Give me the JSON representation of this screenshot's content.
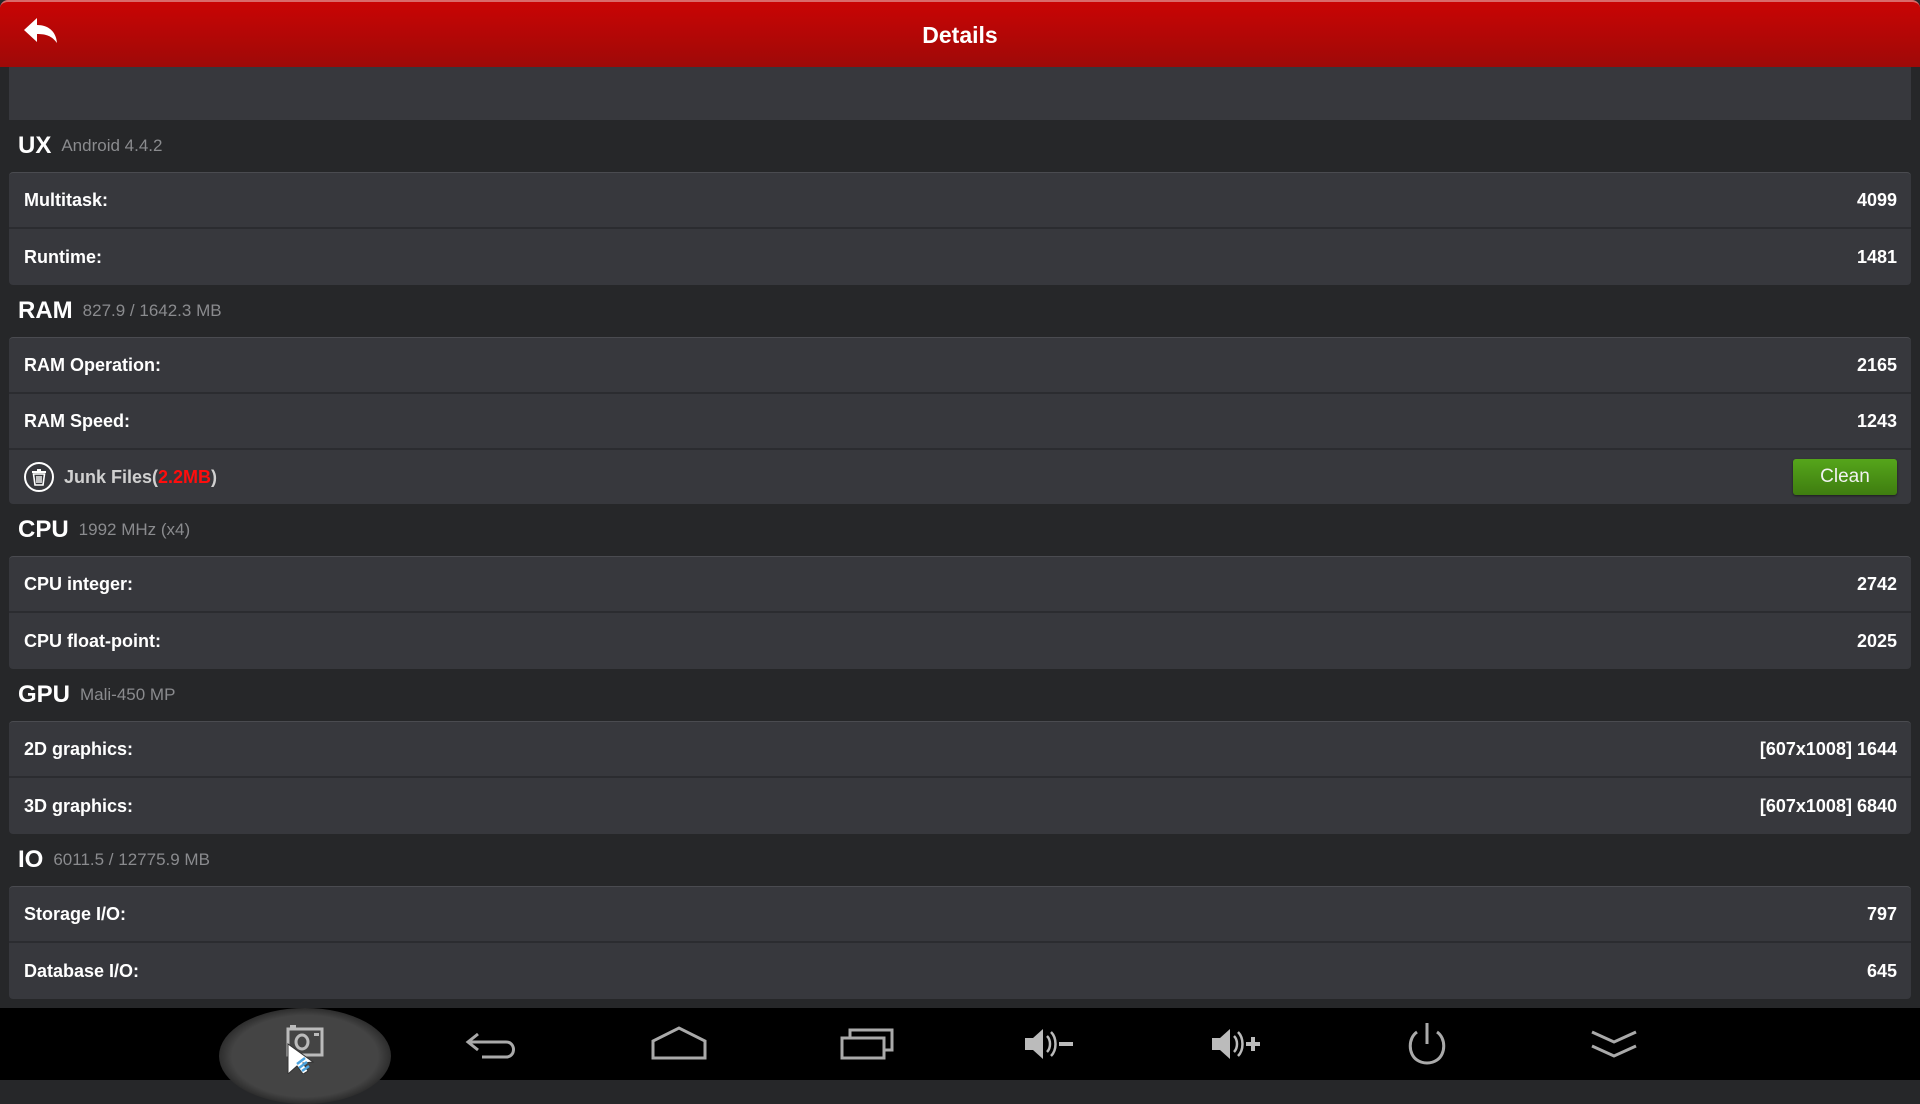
{
  "header": {
    "title": "Details",
    "back_icon": "back-arrow-icon"
  },
  "sections": {
    "ux": {
      "title": "UX",
      "subtitle": "Android 4.4.2",
      "rows": [
        {
          "label": "Multitask:",
          "value": "4099"
        },
        {
          "label": "Runtime:",
          "value": "1481"
        }
      ]
    },
    "ram": {
      "title": "RAM",
      "subtitle": "827.9 / 1642.3 MB",
      "rows": [
        {
          "label": "RAM Operation:",
          "value": "2165"
        },
        {
          "label": "RAM Speed:",
          "value": "1243"
        }
      ],
      "junk": {
        "label": "Junk Files(",
        "size": "2.2MB",
        "close": ")",
        "button": "Clean",
        "icon": "trash-icon"
      }
    },
    "cpu": {
      "title": "CPU",
      "subtitle": "1992 MHz (x4)",
      "rows": [
        {
          "label": "CPU integer:",
          "value": "2742"
        },
        {
          "label": "CPU float-point:",
          "value": "2025"
        }
      ]
    },
    "gpu": {
      "title": "GPU",
      "subtitle": "Mali-450 MP",
      "rows": [
        {
          "label": "2D graphics:",
          "value": "[607x1008] 1644"
        },
        {
          "label": "3D graphics:",
          "value": "[607x1008] 6840"
        }
      ]
    },
    "io": {
      "title": "IO",
      "subtitle": "6011.5 / 12775.9 MB",
      "rows": [
        {
          "label": "Storage I/O:",
          "value": "797"
        },
        {
          "label": "Database I/O:",
          "value": "645"
        }
      ]
    }
  },
  "navbar": {
    "buttons": [
      "screenshot-icon",
      "back-icon",
      "home-icon",
      "recent-apps-icon",
      "volume-down-icon",
      "volume-up-icon",
      "power-icon",
      "collapse-icon"
    ]
  },
  "colors": {
    "header_red": "#c90404",
    "clean_green": "#4f9a18",
    "junk_size_red": "#ff0d0d"
  }
}
